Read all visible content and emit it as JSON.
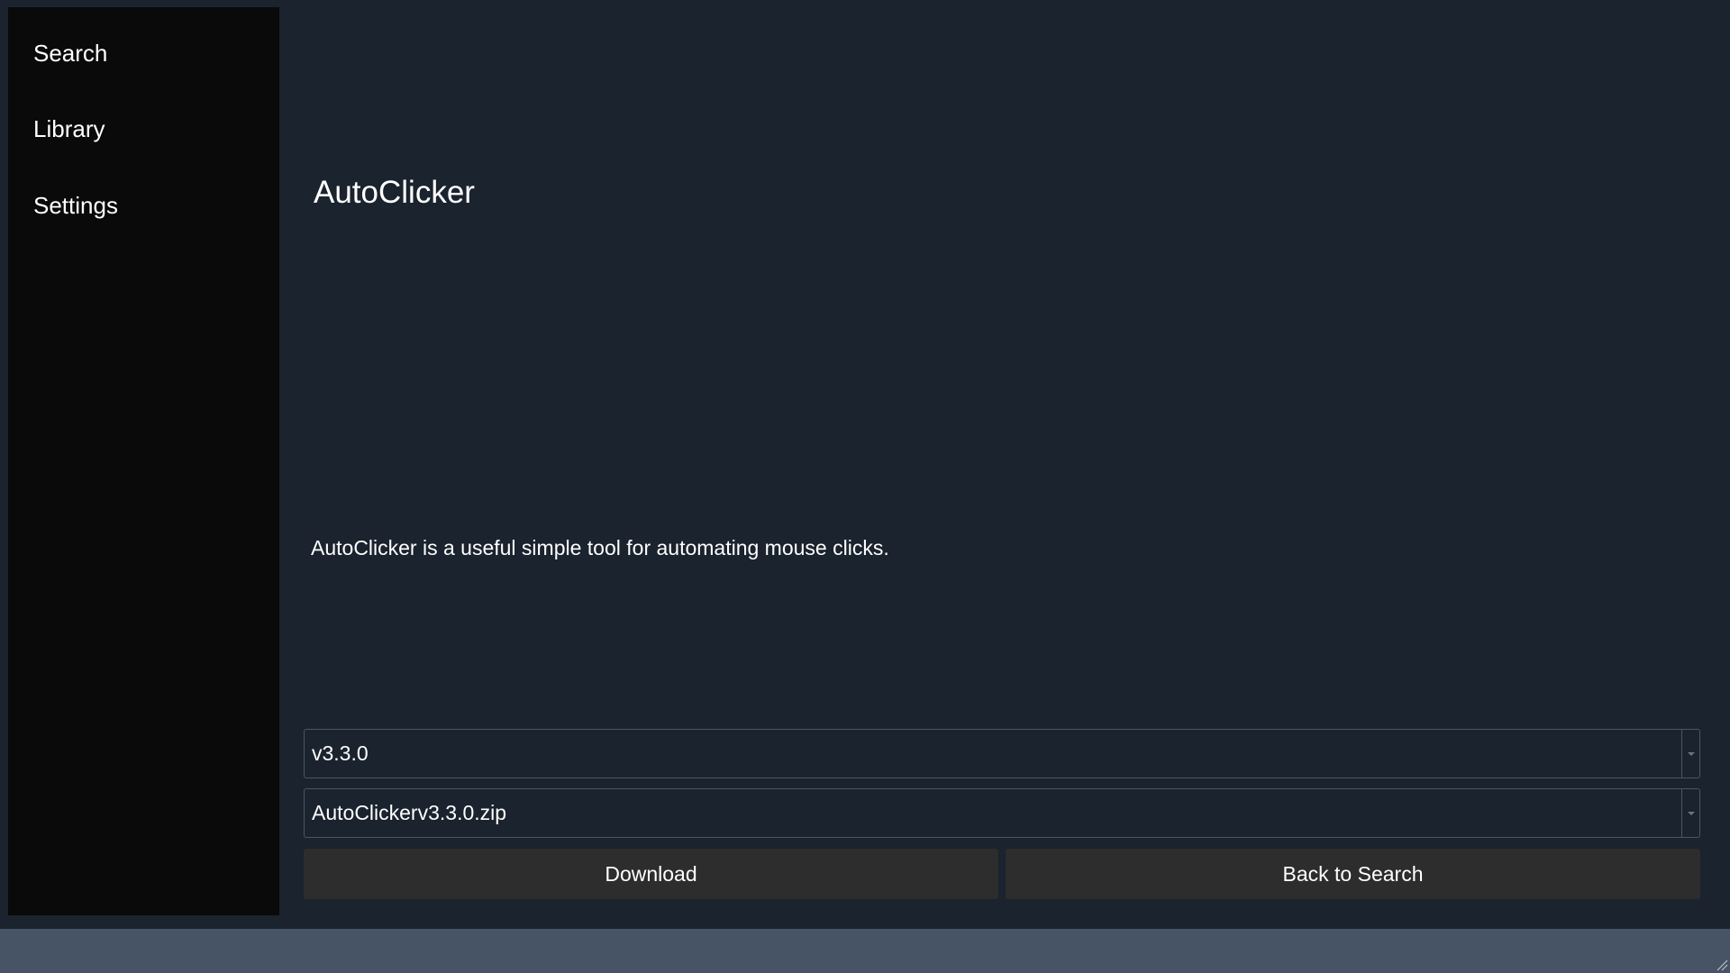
{
  "sidebar": {
    "items": [
      {
        "label": "Search"
      },
      {
        "label": "Library"
      },
      {
        "label": "Settings"
      }
    ]
  },
  "main": {
    "title": "AutoClicker",
    "description": "AutoClicker is a useful simple tool for automating mouse clicks.",
    "version_select": {
      "value": "v3.3.0"
    },
    "file_select": {
      "value": "AutoClickerv3.3.0.zip"
    },
    "download_label": "Download",
    "back_label": "Back to Search"
  },
  "colors": {
    "background": "#1a232e",
    "sidebar": "#0a0a0a",
    "button": "#2d2d2d",
    "statusbar": "#465465"
  },
  "icons": {
    "dropdown": "chevron-down-icon",
    "resize": "resize-grip-icon"
  }
}
